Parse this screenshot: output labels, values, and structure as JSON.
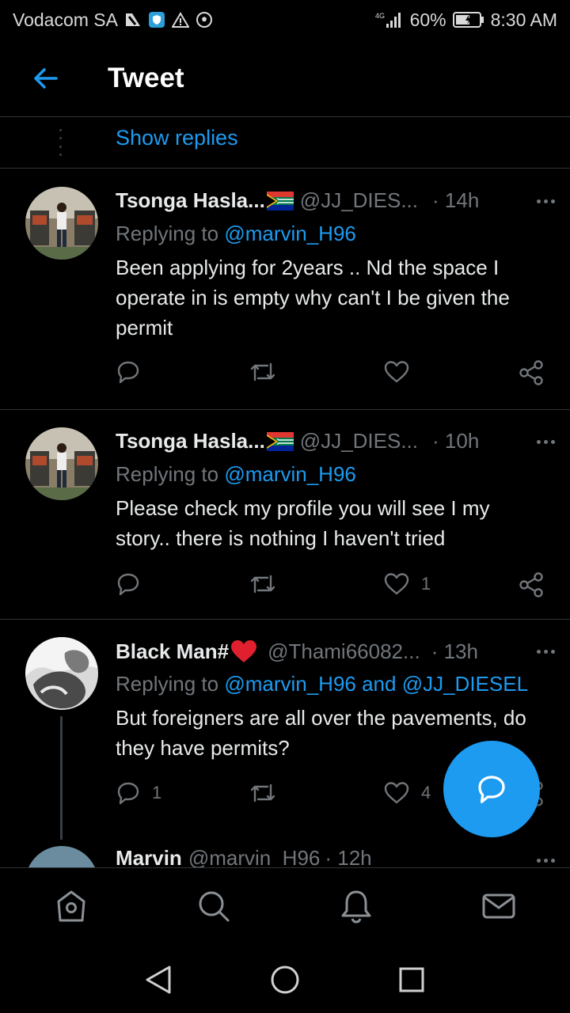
{
  "status_bar": {
    "carrier": "Vodacom SA",
    "network": "4G",
    "battery": "60%",
    "time": "8:30 AM"
  },
  "header": {
    "title": "Tweet"
  },
  "show_replies": "Show replies",
  "tweets": [
    {
      "name": "Tsonga Hasla...",
      "handle": "@JJ_DIES...",
      "time": "· 14h",
      "replying_prefix": "Replying to",
      "replying_to": "@marvin_H96",
      "text": "Been applying for 2years ..   Nd the space I operate in is empty why can't I be given the permit",
      "like_count": ""
    },
    {
      "name": "Tsonga Hasla...",
      "handle": "@JJ_DIES...",
      "time": "· 10h",
      "replying_prefix": "Replying to",
      "replying_to": "@marvin_H96",
      "text": "Please check my profile you will see I my story.. there is nothing I haven't tried",
      "like_count": "1"
    },
    {
      "name": "Black Man#",
      "handle": "@Thami66082...",
      "time": "· 13h",
      "replying_prefix": "Replying to",
      "replying_to": "@marvin_H96 and @JJ_DIESEL",
      "text": "But foreigners are all over the pavements, do they have permits?",
      "reply_count": "1",
      "like_count": "4"
    },
    {
      "name": "Marvin",
      "handle": "@marvin_H96",
      "time": "· 12h"
    }
  ],
  "icons": {
    "back": "arrow-left-icon",
    "reply": "speech-bubble-icon",
    "retweet": "retweet-icon",
    "like": "heart-icon",
    "share": "share-icon",
    "more": "more-dots-icon",
    "compose": "reply-compose-icon",
    "nav_home": "home-icon",
    "nav_search": "search-icon",
    "nav_notifications": "bell-icon",
    "nav_messages": "mail-icon"
  },
  "colors": {
    "accent": "#1d9bf0",
    "background": "#000000",
    "muted": "#71767b",
    "divider": "#2f3336"
  }
}
